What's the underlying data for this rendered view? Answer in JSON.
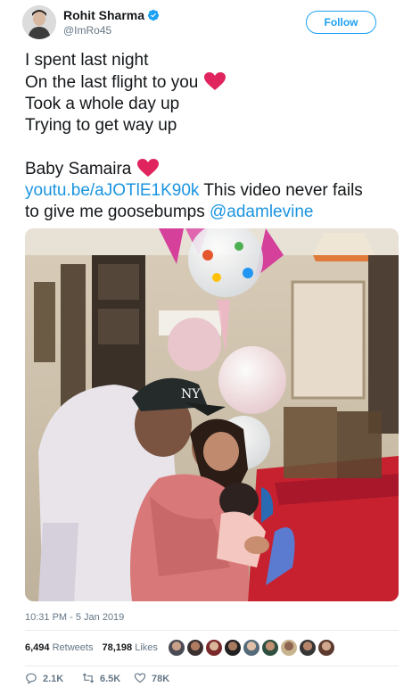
{
  "author": {
    "display_name": "Rohit Sharma",
    "handle": "@ImRo45",
    "verified": true
  },
  "follow_label": "Follow",
  "tweet": {
    "lines": [
      "I spent last night",
      "On the last flight to you",
      "Took a whole day up",
      "Trying to get way up"
    ],
    "baby_line": "Baby Samaira",
    "link_text": "youtu.be/aJOTlE1K90k",
    "after_link": " This video never fails",
    "line_last_prefix": "to give me goosebumps ",
    "mention": "@adamlevine"
  },
  "timestamp": "10:31 PM - 5 Jan 2019",
  "stats": {
    "retweets_count": "6,494",
    "retweets_label": "Retweets",
    "likes_count": "78,198",
    "likes_label": "Likes"
  },
  "actions": {
    "reply_count": "2.1K",
    "retweet_count": "6.5K",
    "like_count": "78K"
  },
  "colors": {
    "link": "#1b95e0",
    "heart": "#e0245e",
    "follow": "#1da1f2",
    "meta": "#657786"
  }
}
